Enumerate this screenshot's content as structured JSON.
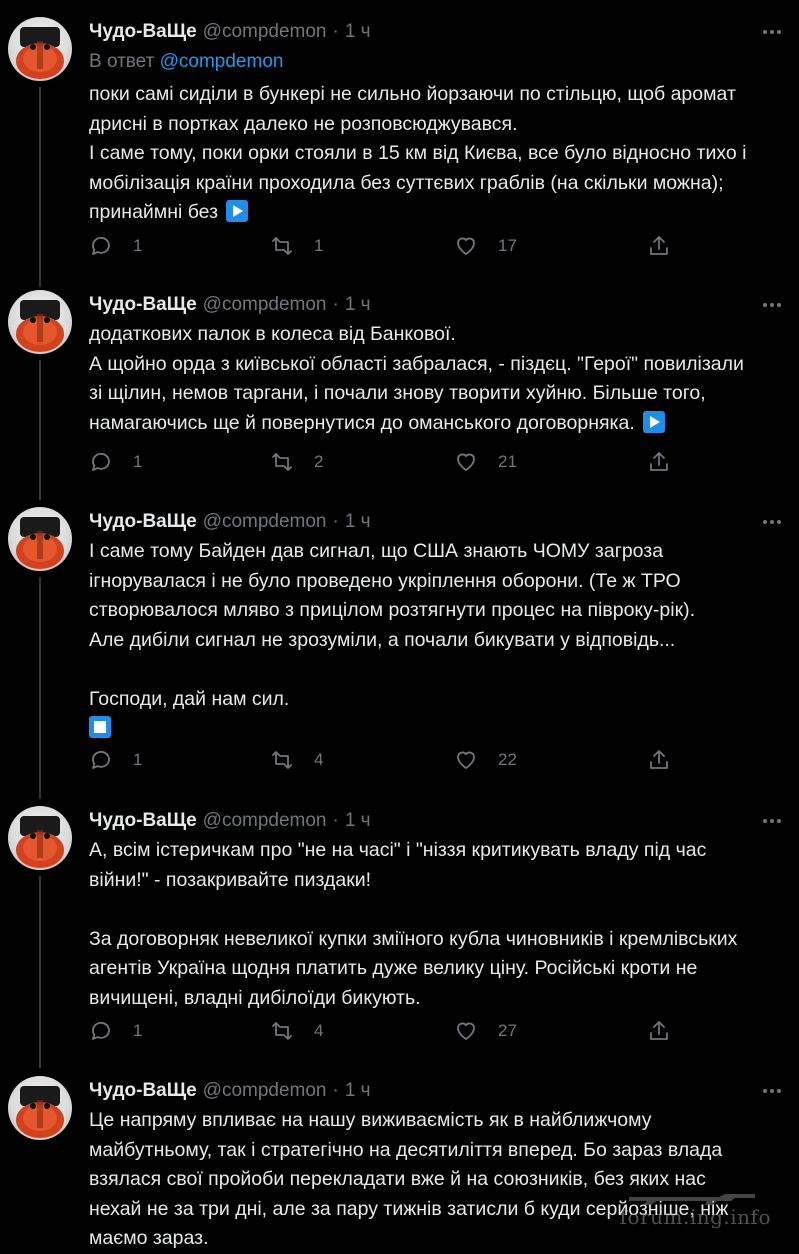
{
  "colors": {
    "background": "#000000",
    "text": "#e7e9ea",
    "muted": "#71767b",
    "link": "#1d9bf0",
    "emoji_bg": "#1f8ee8"
  },
  "tweets": [
    {
      "author_name": "Чудо-ВаЩе",
      "author_handle": "@compdemon",
      "separator": "·",
      "time": "1 ч",
      "reply_prefix": "В ответ",
      "reply_handle": "@compdemon",
      "lines": [
        "поки самі сиділи в бункері не сильно йорзаючи по стільцю, щоб аромат",
        "дрисні в портках далеко не розповсюджувався.",
        "І саме тому, поки орки стояли в 15 км від Києва, все було відносно тихо і",
        "мобілізація країни проходила без суттєвих граблів (на скільки можна);",
        "принаймні без"
      ],
      "trailing_emoji": "play-button-emoji",
      "replies": "1",
      "retweets": "1",
      "likes": "17"
    },
    {
      "author_name": "Чудо-ВаЩе",
      "author_handle": "@compdemon",
      "separator": "·",
      "time": "1 ч",
      "lines": [
        "додаткових палок в колеса від Банкової.",
        "А щойно орда з київської області забралася, - піздєц. \"Герої\" повилізали",
        "зі щілин, немов таргани, і почали знову творити хуйню. Більше того,",
        "намагаючись ще й повернутися до оманського договорняка."
      ],
      "trailing_emoji": "play-button-emoji",
      "replies": "1",
      "retweets": "2",
      "likes": "21"
    },
    {
      "author_name": "Чудо-ВаЩе",
      "author_handle": "@compdemon",
      "separator": "·",
      "time": "1 ч",
      "lines": [
        "І саме тому Байден дав сигнал, що США знають ЧОМУ загроза",
        "ігнорувалася і не було проведено укріплення оборони. (Те ж ТРО",
        "створювалося мляво з прицілом розтягнути процес на півроку-рік).",
        "Але дибіли сигнал не зрозуміли, а почали бикувати у відповідь...",
        "",
        "Господи, дай нам сил."
      ],
      "trailing_emoji": "stop-button-emoji",
      "replies": "1",
      "retweets": "4",
      "likes": "22"
    },
    {
      "author_name": "Чудо-ВаЩе",
      "author_handle": "@compdemon",
      "separator": "·",
      "time": "1 ч",
      "lines": [
        "А, всім істеричкам про \"не на часі\" і \"ніззя критикувать владу під час",
        "війни!\" - позакривайте пиздаки!",
        "",
        "За договорняк невеликої купки зміїного кубла чиновників і кремлівських",
        "агентів Україна щодня платить дуже велику ціну. Російські кроти не",
        "вичищені, владні дибілоїди бикують."
      ],
      "replies": "1",
      "retweets": "4",
      "likes": "27"
    },
    {
      "author_name": "Чудо-ВаЩе",
      "author_handle": "@compdemon",
      "separator": "·",
      "time": "1 ч",
      "lines": [
        "Це напряму впливає на нашу виживаємість як в найближчому",
        "майбутньому, так і стратегічно на десятиліття вперед. Бо зараз влада",
        "взялася свої пройоби перекладати вже й на союзників, без яких нас",
        "нехай не за три дні, але за пару тижнів затисли б куди серйозніше, ніж",
        "маємо зараз."
      ]
    }
  ],
  "watermark": "forum.ing.info"
}
